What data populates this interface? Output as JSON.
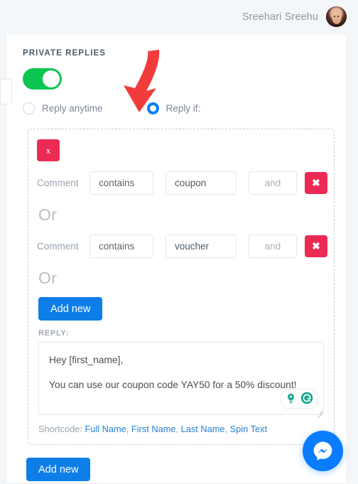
{
  "header": {
    "user_name": "Sreehari Sreehu",
    "avatar_alt": "user-avatar"
  },
  "panel": {
    "section_title": "PRIVATE REPLIES",
    "toggle_state": "on",
    "radios": [
      {
        "label": "Reply anytime",
        "selected": false
      },
      {
        "label": "Reply if:",
        "selected": true
      }
    ],
    "group": {
      "remove_group_label": "x",
      "conditions": [
        {
          "subject": "Comment",
          "operator": "contains",
          "value": "coupon",
          "joiner": "and",
          "delete_label": "✖"
        },
        {
          "subject": "Comment",
          "operator": "contains",
          "value": "voucher",
          "joiner": "and",
          "delete_label": "✖"
        }
      ],
      "or_label": "Or",
      "add_new_label": "Add new",
      "reply_label": "REPLY:",
      "reply_lines": [
        "Hey [first_name],",
        "You can use our coupon code YAY50 for a 50% discount!"
      ],
      "shortcode_label": "Shortcode:",
      "shortcodes": [
        "Full Name",
        "First Name",
        "Last Name",
        "Spin Text"
      ]
    },
    "add_new_bottom_label": "Add new"
  },
  "widgets": {
    "messenger_label": "messenger-chat",
    "grammarly_label": "grammarly-assistant"
  },
  "colors": {
    "accent_blue": "#0d7ee8",
    "danger_red": "#ec2b54",
    "toggle_green": "#0ac650",
    "arrow_red": "#f23c3c",
    "messenger_blue": "#0a7cff",
    "grammarly_green": "#15a88b"
  }
}
